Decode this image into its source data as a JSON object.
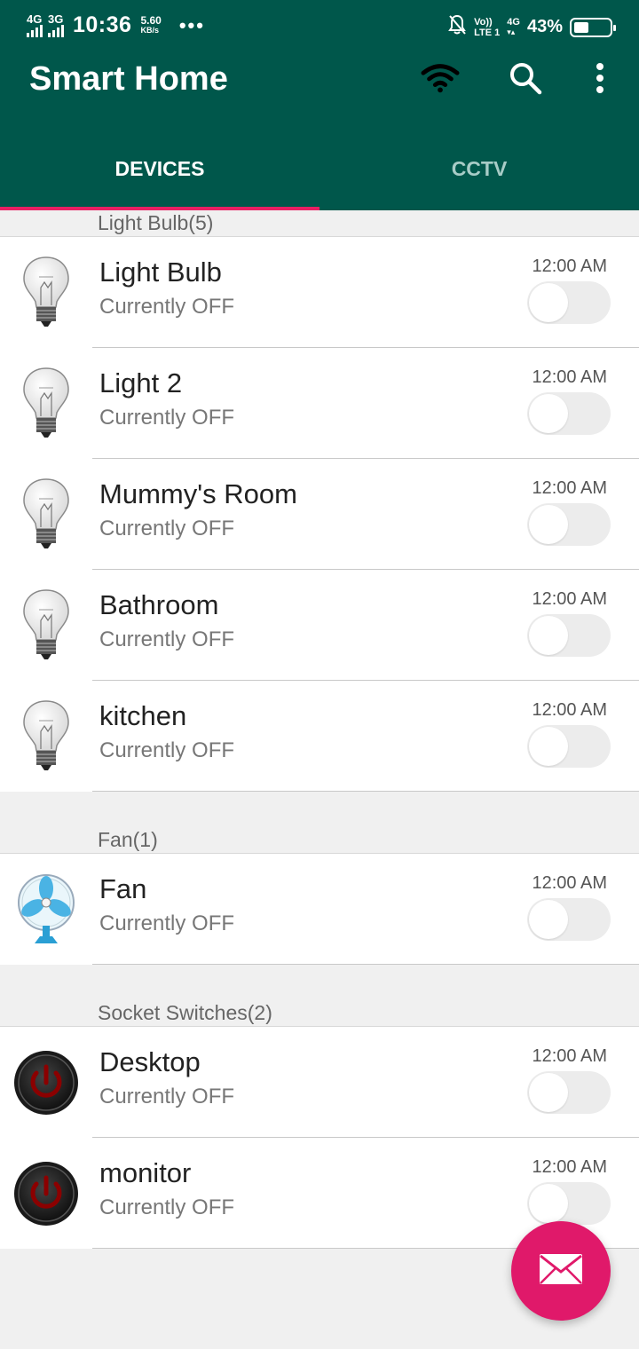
{
  "status_bar": {
    "sim1_network": "4G",
    "sim2_network": "3G",
    "time": "10:36",
    "speed_value": "5.60",
    "speed_unit": "KB/s",
    "more": "•••",
    "volte_top": "Vo))",
    "volte_bottom": "LTE 1",
    "net_right": "4G",
    "battery_percent": "43%",
    "battery_level": 0.43
  },
  "app_bar": {
    "title": "Smart Home",
    "icons": [
      "wifi-icon",
      "search-icon",
      "more-vertical-icon"
    ]
  },
  "tabs": [
    {
      "label": "DEVICES",
      "active": true
    },
    {
      "label": "CCTV",
      "active": false
    }
  ],
  "sections": [
    {
      "title": "Light Bulb(5)",
      "devices": [
        {
          "name": "Light Bulb",
          "status": "Currently OFF",
          "time": "12:00 AM",
          "icon": "light-bulb-icon",
          "on": false
        },
        {
          "name": "Light 2",
          "status": "Currently OFF",
          "time": "12:00 AM",
          "icon": "light-bulb-icon",
          "on": false
        },
        {
          "name": "Mummy's Room",
          "status": "Currently OFF",
          "time": "12:00 AM",
          "icon": "light-bulb-icon",
          "on": false
        },
        {
          "name": "Bathroom",
          "status": "Currently OFF",
          "time": "12:00 AM",
          "icon": "light-bulb-icon",
          "on": false
        },
        {
          "name": "kitchen",
          "status": "Currently OFF",
          "time": "12:00 AM",
          "icon": "light-bulb-icon",
          "on": false
        }
      ]
    },
    {
      "title": "Fan(1)",
      "devices": [
        {
          "name": "Fan",
          "status": "Currently OFF",
          "time": "12:00 AM",
          "icon": "fan-icon",
          "on": false
        }
      ]
    },
    {
      "title": "Socket Switches(2)",
      "devices": [
        {
          "name": "Desktop",
          "status": "Currently OFF",
          "time": "12:00 AM",
          "icon": "power-icon",
          "on": false
        },
        {
          "name": "monitor",
          "status": "Currently OFF",
          "time": "12:00 AM",
          "icon": "power-icon",
          "on": false
        }
      ]
    }
  ],
  "fab": {
    "icon": "mail-icon"
  },
  "colors": {
    "primary": "#00574b",
    "accent": "#e91e63",
    "fab": "#e0196a"
  }
}
